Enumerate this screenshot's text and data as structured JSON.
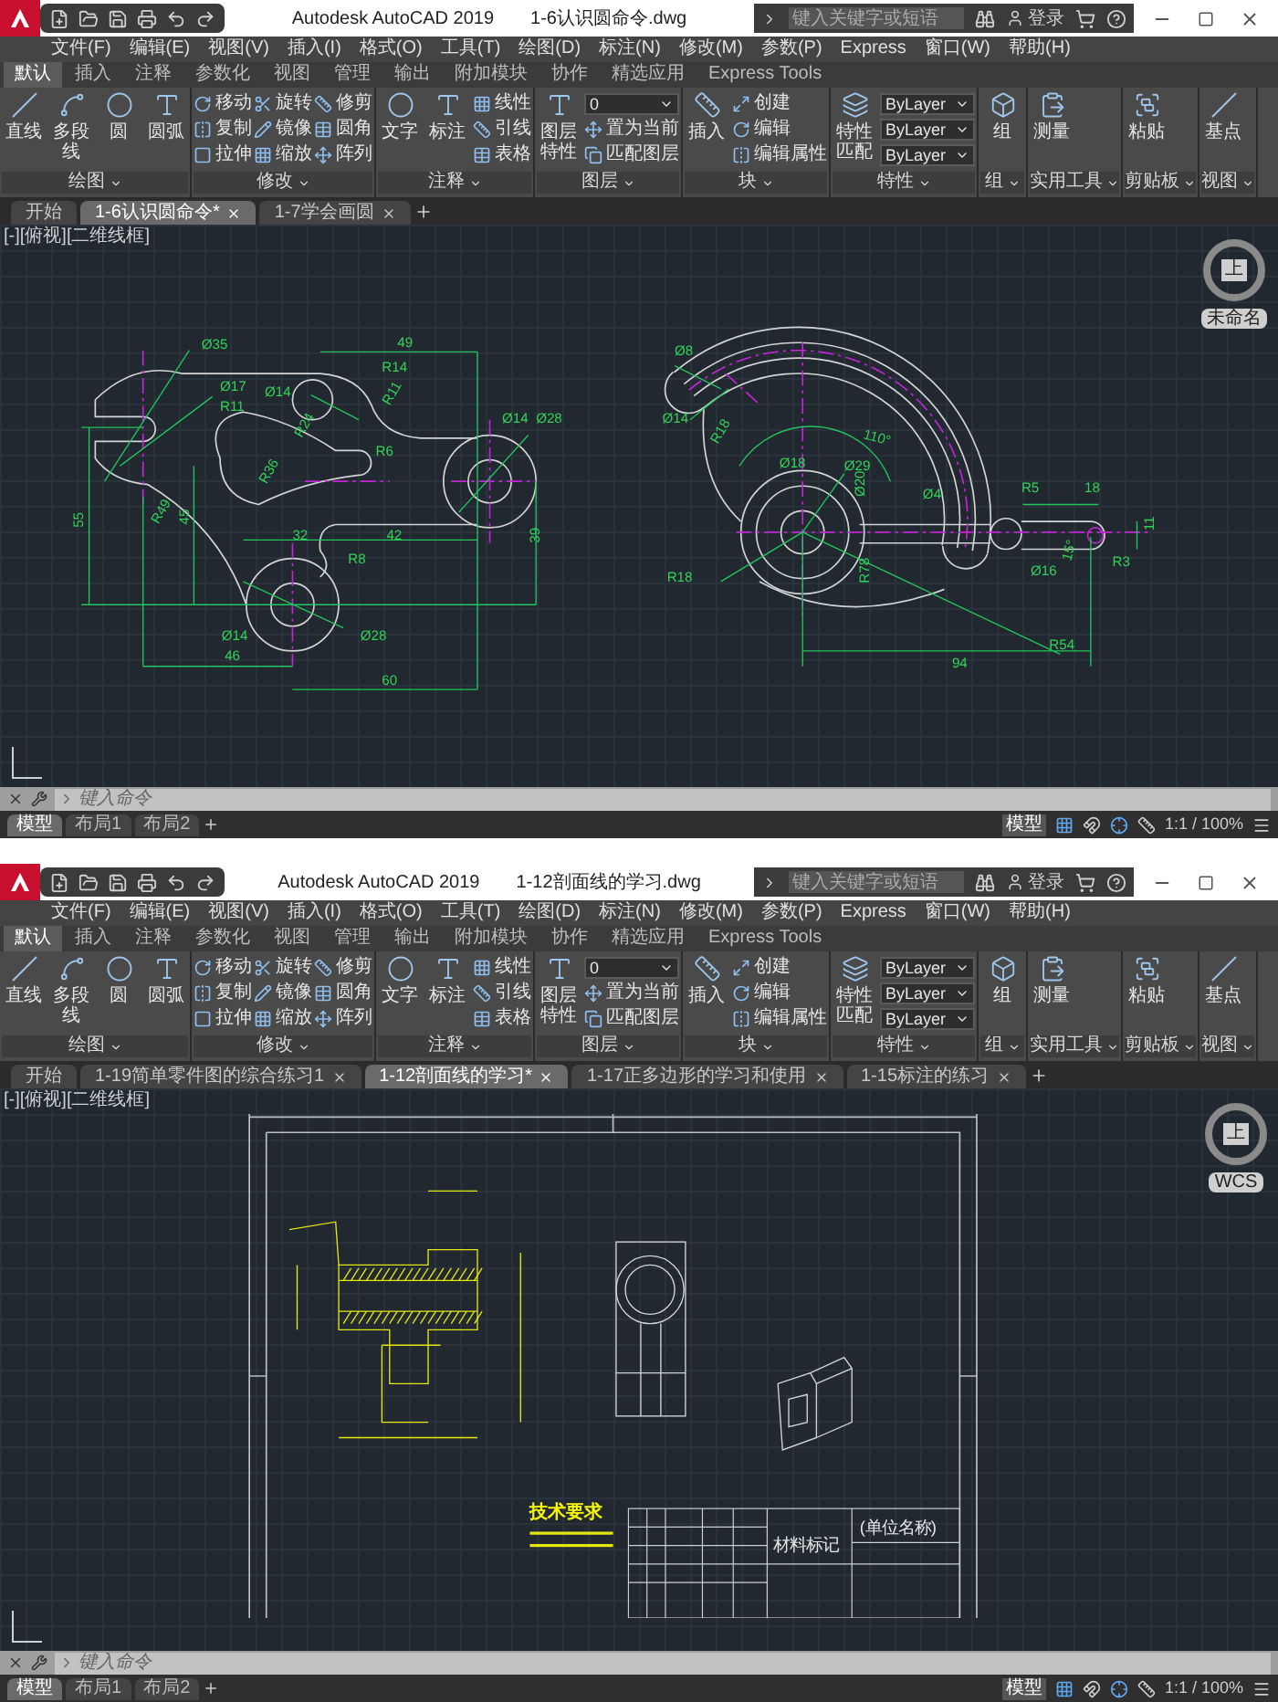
{
  "windows": [
    {
      "app_title": "Autodesk AutoCAD 2019",
      "file_title": "1-6认识圆命令.dwg",
      "search": {
        "placeholder": "键入关键字或短语"
      },
      "sign_in": "登录",
      "menu": [
        "文件(F)",
        "编辑(E)",
        "视图(V)",
        "插入(I)",
        "格式(O)",
        "工具(T)",
        "绘图(D)",
        "标注(N)",
        "修改(M)",
        "参数(P)",
        "Express",
        "窗口(W)",
        "帮助(H)"
      ],
      "ribbon_tabs": [
        {
          "label": "默认",
          "selected": true
        },
        {
          "label": "插入",
          "selected": false
        },
        {
          "label": "注释",
          "selected": false
        },
        {
          "label": "参数化",
          "selected": false
        },
        {
          "label": "视图",
          "selected": false
        },
        {
          "label": "管理",
          "selected": false
        },
        {
          "label": "输出",
          "selected": false
        },
        {
          "label": "附加模块",
          "selected": false
        },
        {
          "label": "协作",
          "selected": false
        },
        {
          "label": "精选应用",
          "selected": false
        },
        {
          "label": "Express Tools",
          "selected": false
        }
      ],
      "panels": [
        {
          "title": "绘图",
          "items": [
            {
              "kind": "large",
              "label": "直线"
            },
            {
              "kind": "large",
              "label": "多段线"
            },
            {
              "kind": "large",
              "label": "圆"
            },
            {
              "kind": "large",
              "label": "圆弧"
            }
          ]
        },
        {
          "title": "修改",
          "items": [
            {
              "kind": "small",
              "label": "移动"
            },
            {
              "kind": "small",
              "label": "复制"
            },
            {
              "kind": "small",
              "label": "拉伸"
            },
            {
              "kind": "small",
              "label": "旋转"
            },
            {
              "kind": "small",
              "label": "镜像"
            },
            {
              "kind": "small",
              "label": "缩放"
            },
            {
              "kind": "small",
              "label": "修剪"
            },
            {
              "kind": "small",
              "label": "圆角"
            },
            {
              "kind": "small",
              "label": "阵列"
            }
          ]
        },
        {
          "title": "注释",
          "items": [
            {
              "kind": "large",
              "label": "文字"
            },
            {
              "kind": "large",
              "label": "标注"
            },
            {
              "kind": "small",
              "label": "线性"
            },
            {
              "kind": "small",
              "label": "引线"
            },
            {
              "kind": "small",
              "label": "表格"
            }
          ]
        },
        {
          "title": "图层",
          "items": [
            {
              "kind": "large",
              "label": "图层特性"
            },
            {
              "kind": "dropdown",
              "label": "0"
            },
            {
              "kind": "small",
              "label": "置为当前"
            },
            {
              "kind": "small",
              "label": "匹配图层"
            }
          ]
        },
        {
          "title": "块",
          "items": [
            {
              "kind": "large",
              "label": "插入"
            },
            {
              "kind": "small",
              "label": "创建"
            },
            {
              "kind": "small",
              "label": "编辑"
            },
            {
              "kind": "small",
              "label": "编辑属性"
            }
          ]
        },
        {
          "title": "特性",
          "items": [
            {
              "kind": "large",
              "label": "特性匹配"
            },
            {
              "kind": "dropdown",
              "label": "ByLayer"
            },
            {
              "kind": "dropdown",
              "label": "ByLayer"
            },
            {
              "kind": "dropdown",
              "label": "ByLayer"
            }
          ]
        },
        {
          "title": "组",
          "items": [
            {
              "kind": "large",
              "label": "组"
            }
          ]
        },
        {
          "title": "实用工具",
          "items": [
            {
              "kind": "large",
              "label": "测量"
            }
          ]
        },
        {
          "title": "剪贴板",
          "items": [
            {
              "kind": "large",
              "label": "粘贴"
            }
          ]
        },
        {
          "title": "视图",
          "items": [
            {
              "kind": "large",
              "label": "基点"
            }
          ]
        }
      ],
      "doc_tabs": [
        {
          "label": "开始",
          "selected": false
        },
        {
          "label": "1-6认识圆命令*",
          "selected": true
        },
        {
          "label": "1-7学会画圆",
          "selected": false
        }
      ],
      "viewport_label": "[-][俯视][二维线框]",
      "viewcube": {
        "face": "上",
        "label": "未命名"
      },
      "drawing": {
        "kind": "parts",
        "labels": [
          "Ø35",
          "49",
          "Ø17",
          "R11",
          "Ø14",
          "R14",
          "R11",
          "R24",
          "R6",
          "Ø14",
          "Ø28",
          "R36",
          "55",
          "R49",
          "45",
          "32",
          "42",
          "R8",
          "39",
          "Ø14",
          "Ø28",
          "46",
          "60",
          "Ø8",
          "Ø14",
          "R18",
          "110°",
          "Ø18",
          "Ø29",
          "Ø20",
          "Ø4",
          "R5",
          "18",
          "R3",
          "11",
          "15°",
          "R18",
          "R78",
          "Ø16",
          "R54",
          "94"
        ]
      },
      "command": {
        "placeholder": "键入命令"
      },
      "layout_tabs": [
        {
          "label": "模型",
          "selected": true
        },
        {
          "label": "布局1",
          "selected": false
        },
        {
          "label": "布局2",
          "selected": false
        }
      ],
      "status": {
        "model": "模型",
        "scale": "1:1 / 100%"
      }
    },
    {
      "app_title": "Autodesk AutoCAD 2019",
      "file_title": "1-12剖面线的学习.dwg",
      "search": {
        "placeholder": "键入关键字或短语"
      },
      "sign_in": "登录",
      "menu": [
        "文件(F)",
        "编辑(E)",
        "视图(V)",
        "插入(I)",
        "格式(O)",
        "工具(T)",
        "绘图(D)",
        "标注(N)",
        "修改(M)",
        "参数(P)",
        "Express",
        "窗口(W)",
        "帮助(H)"
      ],
      "ribbon_tabs": [
        {
          "label": "默认",
          "selected": true
        },
        {
          "label": "插入",
          "selected": false
        },
        {
          "label": "注释",
          "selected": false
        },
        {
          "label": "参数化",
          "selected": false
        },
        {
          "label": "视图",
          "selected": false
        },
        {
          "label": "管理",
          "selected": false
        },
        {
          "label": "输出",
          "selected": false
        },
        {
          "label": "附加模块",
          "selected": false
        },
        {
          "label": "协作",
          "selected": false
        },
        {
          "label": "精选应用",
          "selected": false
        },
        {
          "label": "Express Tools",
          "selected": false
        }
      ],
      "panels": [
        {
          "title": "绘图",
          "items": [
            {
              "kind": "large",
              "label": "直线"
            },
            {
              "kind": "large",
              "label": "多段线"
            },
            {
              "kind": "large",
              "label": "圆"
            },
            {
              "kind": "large",
              "label": "圆弧"
            }
          ]
        },
        {
          "title": "修改",
          "items": [
            {
              "kind": "small",
              "label": "移动"
            },
            {
              "kind": "small",
              "label": "复制"
            },
            {
              "kind": "small",
              "label": "拉伸"
            },
            {
              "kind": "small",
              "label": "旋转"
            },
            {
              "kind": "small",
              "label": "镜像"
            },
            {
              "kind": "small",
              "label": "缩放"
            },
            {
              "kind": "small",
              "label": "修剪"
            },
            {
              "kind": "small",
              "label": "圆角"
            },
            {
              "kind": "small",
              "label": "阵列"
            }
          ]
        },
        {
          "title": "注释",
          "items": [
            {
              "kind": "large",
              "label": "文字"
            },
            {
              "kind": "large",
              "label": "标注"
            },
            {
              "kind": "small",
              "label": "线性"
            },
            {
              "kind": "small",
              "label": "引线"
            },
            {
              "kind": "small",
              "label": "表格"
            }
          ]
        },
        {
          "title": "图层",
          "items": [
            {
              "kind": "large",
              "label": "图层特性"
            },
            {
              "kind": "dropdown",
              "label": "0"
            },
            {
              "kind": "small",
              "label": "置为当前"
            },
            {
              "kind": "small",
              "label": "匹配图层"
            }
          ]
        },
        {
          "title": "块",
          "items": [
            {
              "kind": "large",
              "label": "插入"
            },
            {
              "kind": "small",
              "label": "创建"
            },
            {
              "kind": "small",
              "label": "编辑"
            },
            {
              "kind": "small",
              "label": "编辑属性"
            }
          ]
        },
        {
          "title": "特性",
          "items": [
            {
              "kind": "large",
              "label": "特性匹配"
            },
            {
              "kind": "dropdown",
              "label": "ByLayer"
            },
            {
              "kind": "dropdown",
              "label": "ByLayer"
            },
            {
              "kind": "dropdown",
              "label": "ByLayer"
            }
          ]
        },
        {
          "title": "组",
          "items": [
            {
              "kind": "large",
              "label": "组"
            }
          ]
        },
        {
          "title": "实用工具",
          "items": [
            {
              "kind": "large",
              "label": "测量"
            }
          ]
        },
        {
          "title": "剪贴板",
          "items": [
            {
              "kind": "large",
              "label": "粘贴"
            }
          ]
        },
        {
          "title": "视图",
          "items": [
            {
              "kind": "large",
              "label": "基点"
            }
          ]
        }
      ],
      "doc_tabs": [
        {
          "label": "开始",
          "selected": false
        },
        {
          "label": "1-19简单零件图的综合练习1",
          "selected": false
        },
        {
          "label": "1-12剖面线的学习*",
          "selected": true
        },
        {
          "label": "1-17正多边形的学习和使用",
          "selected": false
        },
        {
          "label": "1-15标注的练习",
          "selected": false
        }
      ],
      "viewport_label": "[-][俯视][二维线框]",
      "viewcube": {
        "face": "上",
        "label": "WCS"
      },
      "drawing": {
        "kind": "sheet",
        "labels": [
          "技术要求",
          "材料标记",
          "(单位名称)"
        ]
      },
      "command": {
        "placeholder": "键入命令"
      },
      "layout_tabs": [
        {
          "label": "模型",
          "selected": true
        },
        {
          "label": "布局1",
          "selected": false
        },
        {
          "label": "布局2",
          "selected": false
        }
      ],
      "status": {
        "model": "模型",
        "scale": "1:1 / 100%"
      }
    }
  ]
}
